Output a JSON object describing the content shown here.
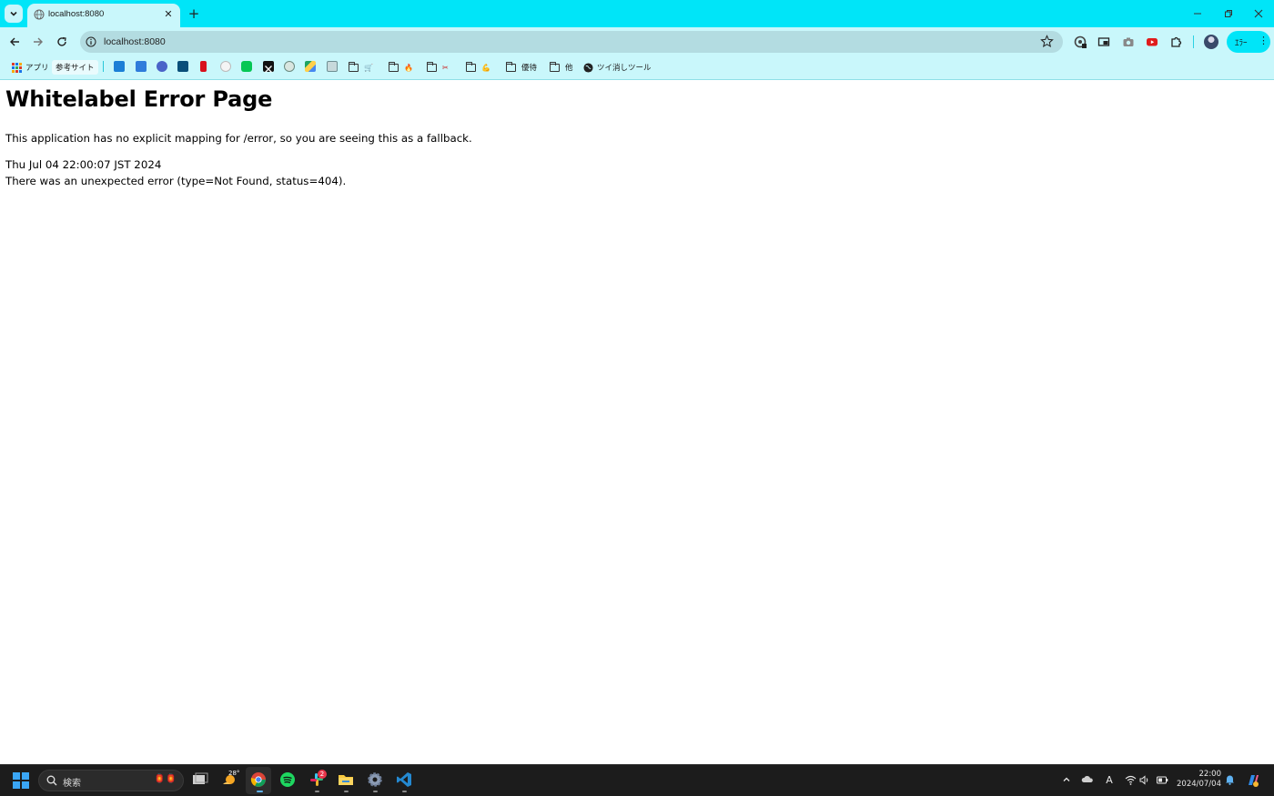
{
  "browser": {
    "tab": {
      "title": "localhost:8080",
      "close_label": "✕"
    },
    "new_tab_label": "+",
    "window_controls": {
      "minimize": "–",
      "restore": "⧉",
      "close": "✕"
    },
    "omnibox": {
      "url": "localhost:8080"
    },
    "profile_pill": {
      "label": "ｴﾗｰ",
      "menu": "⋮"
    },
    "bookmarks": {
      "apps": "アプリ",
      "ref_sites": "参考サイト",
      "folder_yuutai": "優待",
      "folder_other": "他",
      "twitter_tool": "ツイ消しツール"
    },
    "accent_color": "#00e5f8",
    "toolbar_color": "#c9f7fb"
  },
  "page": {
    "heading": "Whitelabel Error Page",
    "message": "This application has no explicit mapping for /error, so you are seeing this as a fallback.",
    "timestamp": "Thu Jul 04 22:00:07 JST 2024",
    "error_detail": "There was an unexpected error (type=Not Found, status=404)."
  },
  "taskbar": {
    "search_label": "検索",
    "weather_temp": "28°",
    "slack_badge": "2",
    "ime_label": "A",
    "time": "22:00",
    "date": "2024/07/04"
  }
}
